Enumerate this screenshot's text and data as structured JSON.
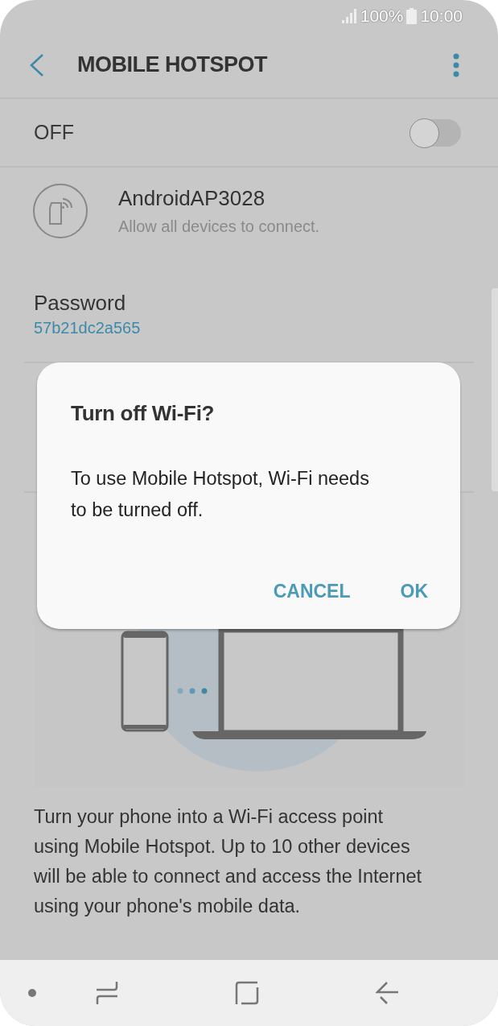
{
  "status_bar": {
    "battery": "100%",
    "time": "10:00"
  },
  "header": {
    "title": "MOBILE HOTSPOT"
  },
  "master_switch": {
    "label": "OFF",
    "on": false
  },
  "network": {
    "name": "AndroidAP3028",
    "subtitle": "Allow all devices to connect."
  },
  "password": {
    "label": "Password",
    "value": "57b21dc2a565"
  },
  "description": "Turn your phone into a Wi-Fi access point using Mobile Hotspot. Up to 10 other devices will be able to connect and access the Internet using your phone's mobile data.",
  "dialog": {
    "title": "Turn off Wi-Fi?",
    "message": "To use Mobile Hotspot, Wi-Fi needs to be turned off.",
    "buttons": [
      "CANCEL",
      "OK"
    ]
  }
}
